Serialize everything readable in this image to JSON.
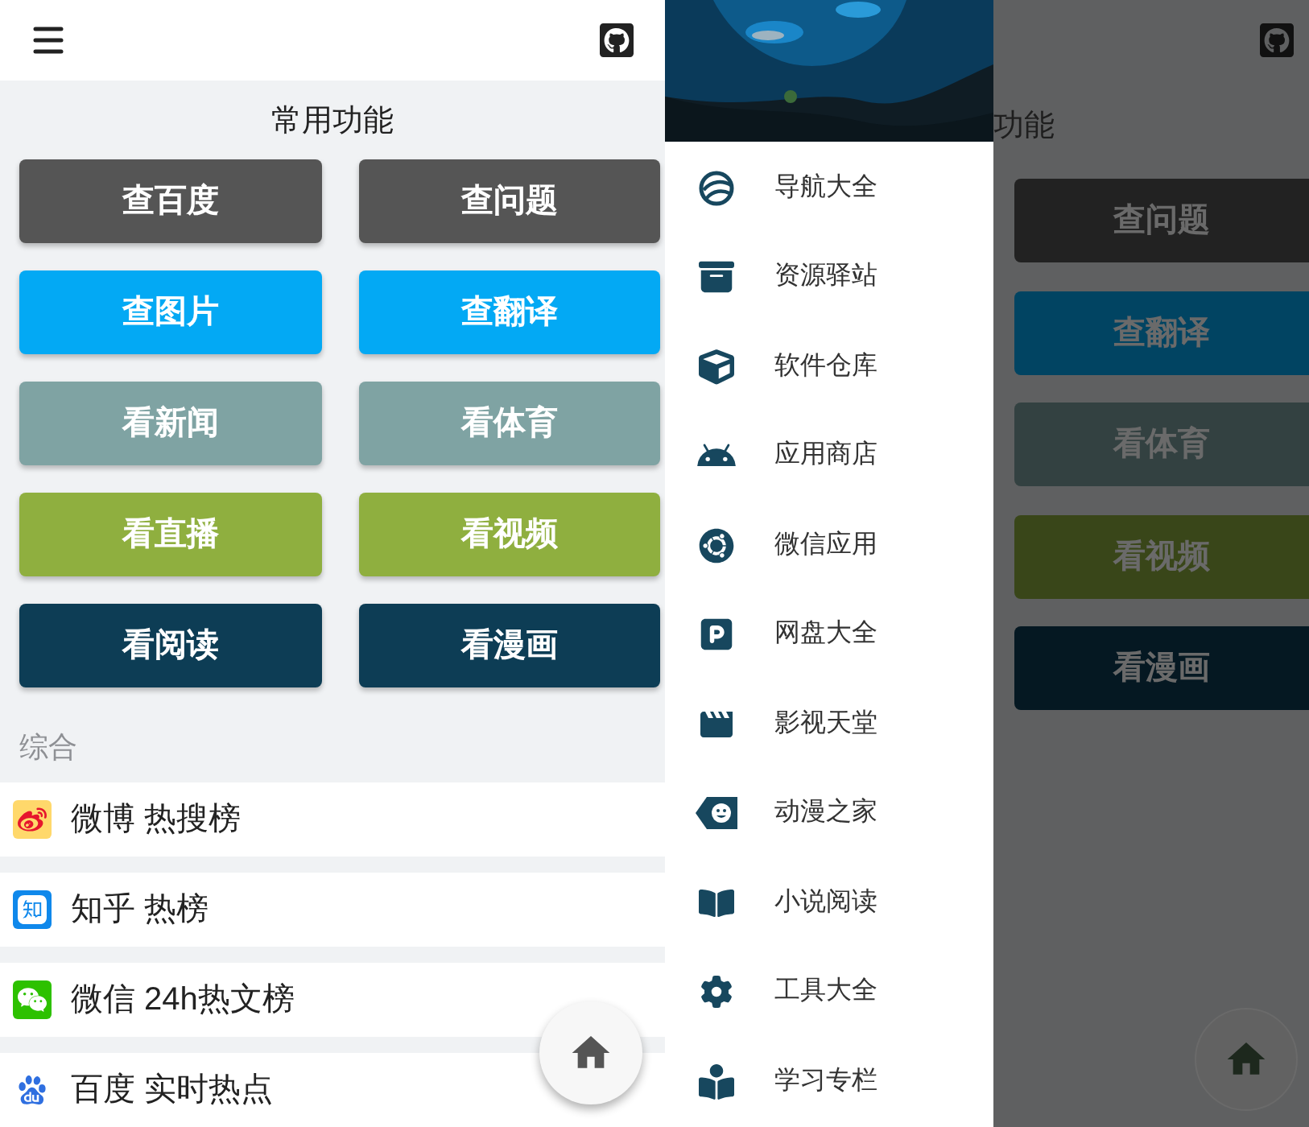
{
  "main_screen": {
    "title": "常用功能",
    "buttons": [
      {
        "label": "查百度",
        "color": "#555555"
      },
      {
        "label": "查问题",
        "color": "#555555"
      },
      {
        "label": "查图片",
        "color": "#03a9f4"
      },
      {
        "label": "查翻译",
        "color": "#03a9f4"
      },
      {
        "label": "看新闻",
        "color": "#7fa3a3"
      },
      {
        "label": "看体育",
        "color": "#7fa3a3"
      },
      {
        "label": "看直播",
        "color": "#8faf3f"
      },
      {
        "label": "看视频",
        "color": "#8faf3f"
      },
      {
        "label": "看阅读",
        "color": "#0d3d55"
      },
      {
        "label": "看漫画",
        "color": "#0d3d55"
      }
    ],
    "section": "综合",
    "hot_lists": [
      {
        "label": "微博 热搜榜"
      },
      {
        "label": "知乎 热榜"
      },
      {
        "label": "微信 24h热文榜"
      },
      {
        "label": "百度 实时热点"
      }
    ]
  },
  "drawer_screen": {
    "drawer_items": [
      {
        "label": "导航大全"
      },
      {
        "label": "资源驿站"
      },
      {
        "label": "软件仓库"
      },
      {
        "label": "应用商店"
      },
      {
        "label": "微信应用"
      },
      {
        "label": "网盘大全"
      },
      {
        "label": "影视天堂"
      },
      {
        "label": "动漫之家"
      },
      {
        "label": "小说阅读"
      },
      {
        "label": "工具大全"
      },
      {
        "label": "学习专栏"
      }
    ],
    "background": {
      "title": "功能",
      "buttons": [
        {
          "label": "查问题",
          "color": "#222222"
        },
        {
          "label": "查翻译",
          "color": "#014462"
        },
        {
          "label": "看体育",
          "color": "#334141"
        },
        {
          "label": "看视频",
          "color": "#394619"
        },
        {
          "label": "看漫画",
          "color": "#051822"
        }
      ]
    }
  }
}
